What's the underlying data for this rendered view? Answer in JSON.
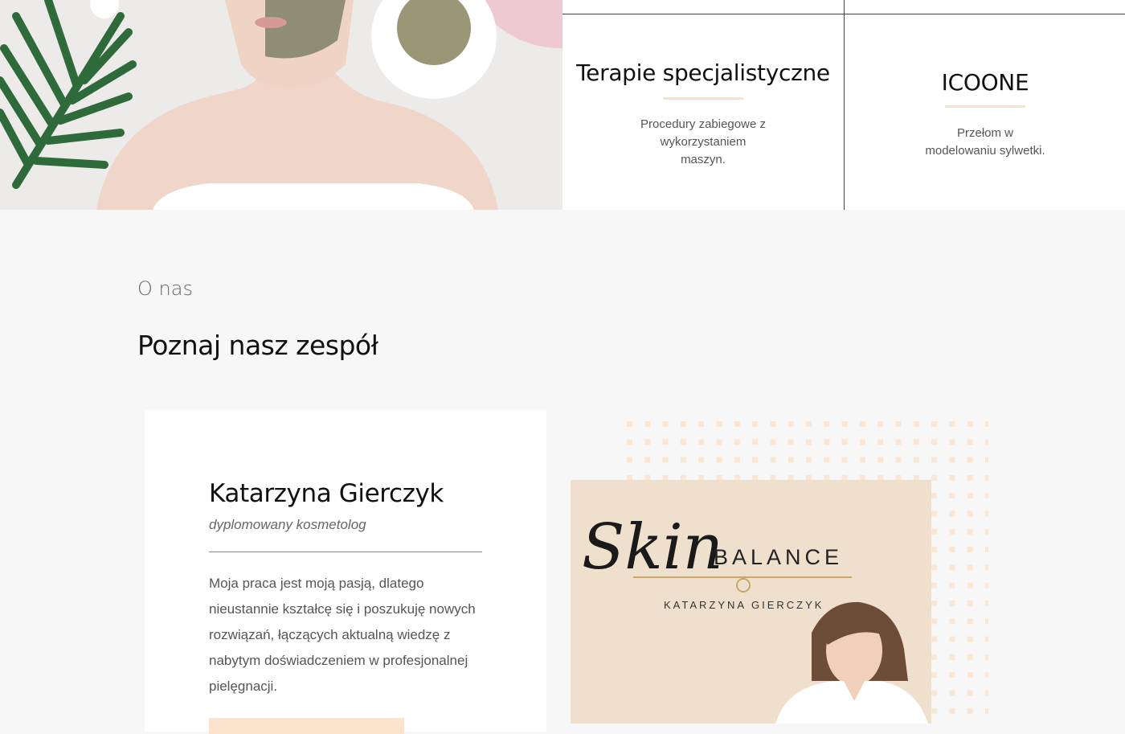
{
  "services": [
    {
      "title": "Terapie specjalistyczne",
      "lines": [
        "Procedury zabiegowe z",
        "wykorzystaniem",
        "maszyn."
      ]
    },
    {
      "title": "ICOONE",
      "lines": [
        "Przełom w",
        "modelowaniu sylwetki."
      ]
    }
  ],
  "about": {
    "eyebrow": "O nas",
    "heading": "Poznaj nasz zespół"
  },
  "team_member": {
    "name": "Katarzyna Gierczyk",
    "role": "dyplomowany kosmetolog",
    "bio": "Moja praca jest moją pasją, dlatego nieustannie kształcę się i poszukuję nowych rozwiązań, łączących aktualną wiedzę z nabytym doświadczeniem w profesjonalnej pielęgnacji."
  },
  "photo_sign": {
    "script": "Skin",
    "brand": "BALANCE",
    "owner": "KATARZYNA GIERCZYK"
  },
  "colors": {
    "accent": "#f8e1cb",
    "background": "#f7f7f7",
    "text": "#111111"
  }
}
